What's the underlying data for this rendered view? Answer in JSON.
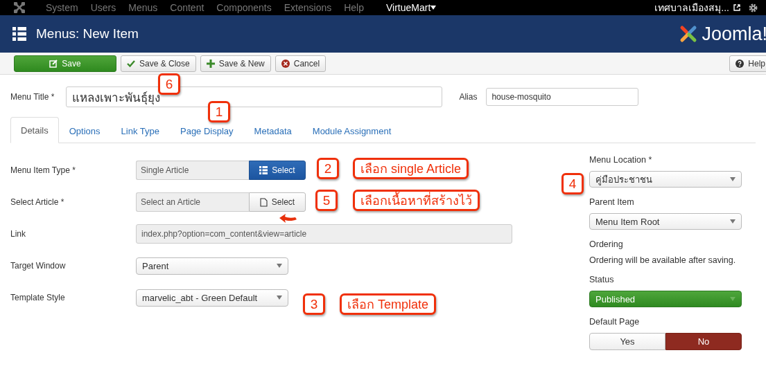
{
  "topnav": {
    "items": [
      {
        "label": "System",
        "highlight": false
      },
      {
        "label": "Users",
        "highlight": false
      },
      {
        "label": "Menus",
        "highlight": false
      },
      {
        "label": "Content",
        "highlight": false
      },
      {
        "label": "Components",
        "highlight": false
      },
      {
        "label": "Extensions",
        "highlight": false
      },
      {
        "label": "Help",
        "highlight": false
      },
      {
        "label": "VirtueMart",
        "highlight": true
      }
    ],
    "site": "เทศบาลเมืองสมุ..."
  },
  "header": {
    "title": "Menus: New Item",
    "brand": "Joomla!"
  },
  "toolbar": {
    "buttons": [
      {
        "label": "Save",
        "kind": "primary"
      },
      {
        "label": "Save & Close",
        "kind": "default"
      },
      {
        "label": "Save & New",
        "kind": "default"
      },
      {
        "label": "Cancel",
        "kind": "default"
      }
    ],
    "help": "Help"
  },
  "menu_title": {
    "label": "Menu Title *",
    "value": "แหลงเพาะพันธุ์ยุง"
  },
  "alias": {
    "label": "Alias",
    "value": "house-mosquito"
  },
  "tabs": [
    {
      "label": "Details",
      "selected": true
    },
    {
      "label": "Options",
      "selected": false
    },
    {
      "label": "Link Type",
      "selected": false
    },
    {
      "label": "Page Display",
      "selected": false
    },
    {
      "label": "Metadata",
      "selected": false
    },
    {
      "label": "Module Assignment",
      "selected": false
    }
  ],
  "fields": [
    {
      "label": "Menu Item Type *",
      "kind": "picker",
      "value": "Single Article",
      "button": "Select",
      "primary": true
    },
    {
      "label": "Select Article *",
      "kind": "picker",
      "value": "Select an Article",
      "button": "Select",
      "primary": false
    },
    {
      "label": "Link",
      "kind": "readonly",
      "value": "index.php?option=com_content&view=article"
    },
    {
      "label": "Target Window",
      "kind": "select",
      "value": "Parent"
    },
    {
      "label": "Template Style",
      "kind": "select",
      "value": "marvelic_abt - Green Default"
    }
  ],
  "side": [
    {
      "label": "Menu Location *",
      "kind": "select",
      "value": "คู่มือประชาชน"
    },
    {
      "label": "Parent Item",
      "kind": "select",
      "value": "Menu Item Root"
    },
    {
      "label": "Ordering",
      "kind": "note",
      "value": "Ordering will be available after saving."
    },
    {
      "label": "Status",
      "kind": "status",
      "value": "Published"
    },
    {
      "label": "Default Page",
      "kind": "toggle",
      "options": [
        {
          "label": "Yes",
          "selected": false
        },
        {
          "label": "No",
          "selected": true
        }
      ]
    }
  ],
  "annotations": [
    {
      "number": "6"
    },
    {
      "number": "1"
    },
    {
      "number": "2",
      "text": "เลือก single Article"
    },
    {
      "number": "5",
      "text": "เลือกเนื้อหาที่สร้างไว้"
    },
    {
      "number": "3",
      "text": "เลือก Template"
    },
    {
      "number": "4"
    }
  ]
}
